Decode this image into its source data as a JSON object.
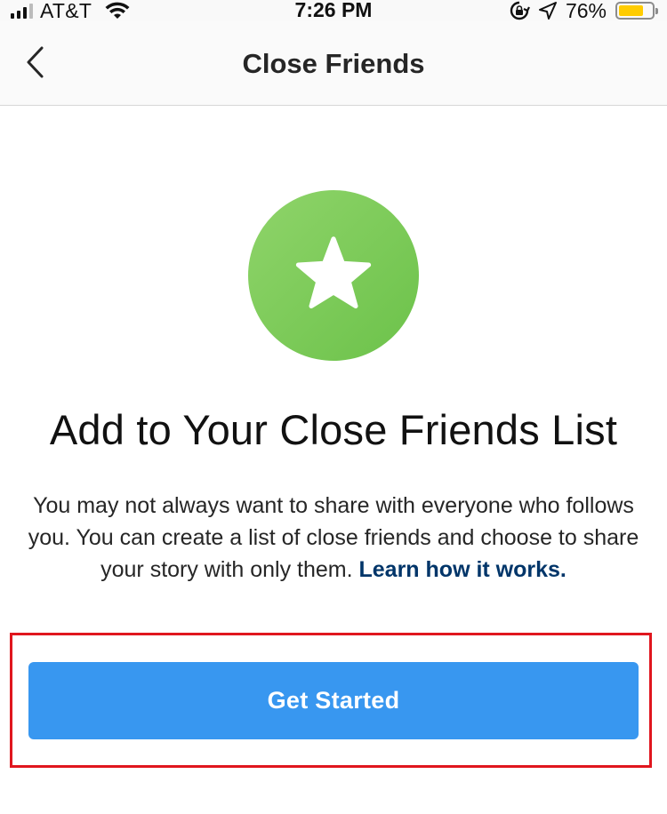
{
  "status_bar": {
    "carrier": "AT&T",
    "time": "7:26 PM",
    "battery_percent": "76%",
    "battery_level": 0.76,
    "battery_color": "#ffcc00",
    "icons": [
      "signal-icon",
      "wifi-icon",
      "lock-rotation-icon",
      "location-icon",
      "battery-icon"
    ]
  },
  "header": {
    "title": "Close Friends",
    "back_icon": "chevron-left-icon"
  },
  "hero": {
    "icon": "star-icon",
    "badge_color": "#78c85a"
  },
  "content": {
    "headline": "Add to Your Close Friends List",
    "description": "You may not always want to share with everyone who follows you. You can create a list of close friends and choose to share your story with only them. ",
    "learn_more_link": "Learn how it works.",
    "link_color": "#003569"
  },
  "cta": {
    "label": "Get Started",
    "color": "#3897f0",
    "highlight_color": "#e0161e"
  }
}
